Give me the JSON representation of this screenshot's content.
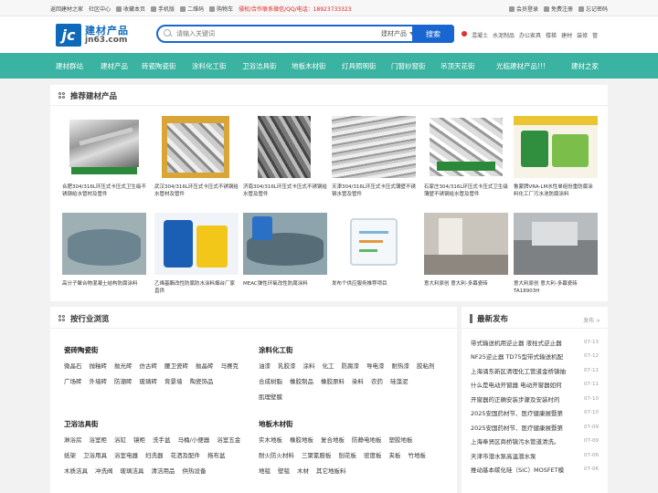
{
  "topbar": {
    "left": [
      "返回建材之家",
      "社区中心",
      "收藏本页",
      "手机版",
      "二维码",
      "购物车"
    ],
    "contact": "侵权/合作联系微信/QQ/电话：18923733323",
    "right": [
      "会员登录",
      "免费注册",
      "忘记密码"
    ]
  },
  "logo": {
    "mark": "jc",
    "cn": "建材产品",
    "en": "jn63.com"
  },
  "search": {
    "placeholder": "请输入关键词",
    "category": "建材产品",
    "button": "搜索"
  },
  "hotlinks": [
    "混凝土",
    "水泥制品",
    "办公家具",
    "楼梯",
    "建材",
    "装修",
    "管"
  ],
  "nav": [
    "建材群站",
    "建材产品",
    "砖瓷陶瓷街",
    "涂料化工街",
    "卫浴洁具街",
    "地板木材街",
    "灯具照明街",
    "门窗纱窗街",
    "吊顶天花街",
    "光临建材产品!!!",
    "建材之家"
  ],
  "recommend": {
    "title": "推荐建材产品",
    "items": [
      {
        "name": "合肥304/316L环压式卡压式卫生级不锈钢给水管材及管件",
        "img": "pipes"
      },
      {
        "name": "武汉304/316L环压式卡压式不锈钢给水管材及管件",
        "img": "fittings"
      },
      {
        "name": "济南304/316L环压式卡压式不锈钢给水管及管件",
        "img": "fittings-dark"
      },
      {
        "name": "天津304/316L环压式卡压式薄壁不锈钢水管及管件",
        "img": "pipes-bundle"
      },
      {
        "name": "石家庄304/316L环压式卡压式卫生级薄壁不锈钢给水管及管件",
        "img": "fittings-box"
      },
      {
        "name": "鲁蒙牌VRA-LM水性单组份重防腐涂料化工厂污水池防腐涂料",
        "img": "paint-green"
      },
      {
        "name": "高分子聚合物混凝土结构防腐涂料",
        "img": "pool"
      },
      {
        "name": "乙烯基酯改性防腐防水涂料烟台厂家直供",
        "img": "buckets"
      },
      {
        "name": "MEAC弹性环氧改性防腐涂料",
        "img": "pool2"
      },
      {
        "name": "发布个供应服务推荐项目",
        "img": "drawing"
      },
      {
        "name": "意大利原创 意大利-多幕瓷砖",
        "img": "room"
      },
      {
        "name": "意大利原创 意大利-多幕瓷砖TA18903H",
        "img": "hall"
      }
    ]
  },
  "industry": {
    "title": "按行业浏览",
    "groups": [
      {
        "title": "瓷砖陶瓷街",
        "links": [
          "微晶石",
          "抛釉砖",
          "抛光砖",
          "仿古砖",
          "腰卫瓷砖",
          "抛晶砖",
          "马赛克",
          "广场砖",
          "外墙砖",
          "防潮砖",
          "玻璃砖",
          "背景墙",
          "陶瓷饰品"
        ]
      },
      {
        "title": "涂料化工街",
        "links": [
          "油漆",
          "乳胶漆",
          "涂料",
          "化工",
          "防腐漆",
          "导电漆",
          "耐热漆",
          "胶粘剂",
          "合成树脂",
          "橡胶制品",
          "橡胶原料",
          "染料",
          "农药",
          "硅藻泥",
          "肌理壁膜"
        ]
      },
      {
        "title": "卫浴洁具街",
        "links": [
          "淋浴房",
          "浴室柜",
          "浴缸",
          "镜柜",
          "洗手盆",
          "马桶/小便器",
          "浴室五金",
          "纸架",
          "卫浴用具",
          "浴室电器",
          "妇洗器",
          "花洒及配件",
          "拖布盆",
          "木质洁具",
          "冲洗阀",
          "玻璃洁具",
          "清洁用品",
          "供热设备"
        ]
      },
      {
        "title": "地板木材街",
        "links": [
          "实木地板",
          "橡胶地板",
          "复合地板",
          "防静电地板",
          "塑胶地板",
          "耐火防火材料",
          "三聚氰胺板",
          "刨花板",
          "密度板",
          "夹板",
          "竹地板",
          "地毯",
          "壁毯",
          "木材",
          "其它地板料"
        ]
      }
    ]
  },
  "news": {
    "title": "最新发布",
    "more": "发布 >",
    "items": [
      {
        "text": "带式输送机用逆止器 液柱式逆止器",
        "date": "07-13"
      },
      {
        "text": "NF25逆止器 TD75型带式输送机配",
        "date": "07-12"
      },
      {
        "text": "上海涌东新区清理化工管道金桥镇抽",
        "date": "07-11"
      },
      {
        "text": "什么是电动开窗器 电动开窗器如何",
        "date": "07-11"
      },
      {
        "text": "开窗器的正确安装步骤及安装时的",
        "date": "07-10"
      },
      {
        "text": "2025安国药材节、医疗健康展暨第",
        "date": "07-10"
      },
      {
        "text": "2025安国药材节、医疗健康展暨第",
        "date": "07-09"
      },
      {
        "text": "上海奉贤区商桥镇污水管道清洗。",
        "date": "07-09"
      },
      {
        "text": "天津市潜水泵高温潜水泵",
        "date": "07-06"
      },
      {
        "text": "推动基本碳化硅（SiC）MOSFET模",
        "date": "07-06"
      }
    ]
  },
  "colors": {
    "nav": "#3bb3a2",
    "brand": "#0e6ab8",
    "search": "#1a66d0",
    "contact": "#e02020"
  }
}
